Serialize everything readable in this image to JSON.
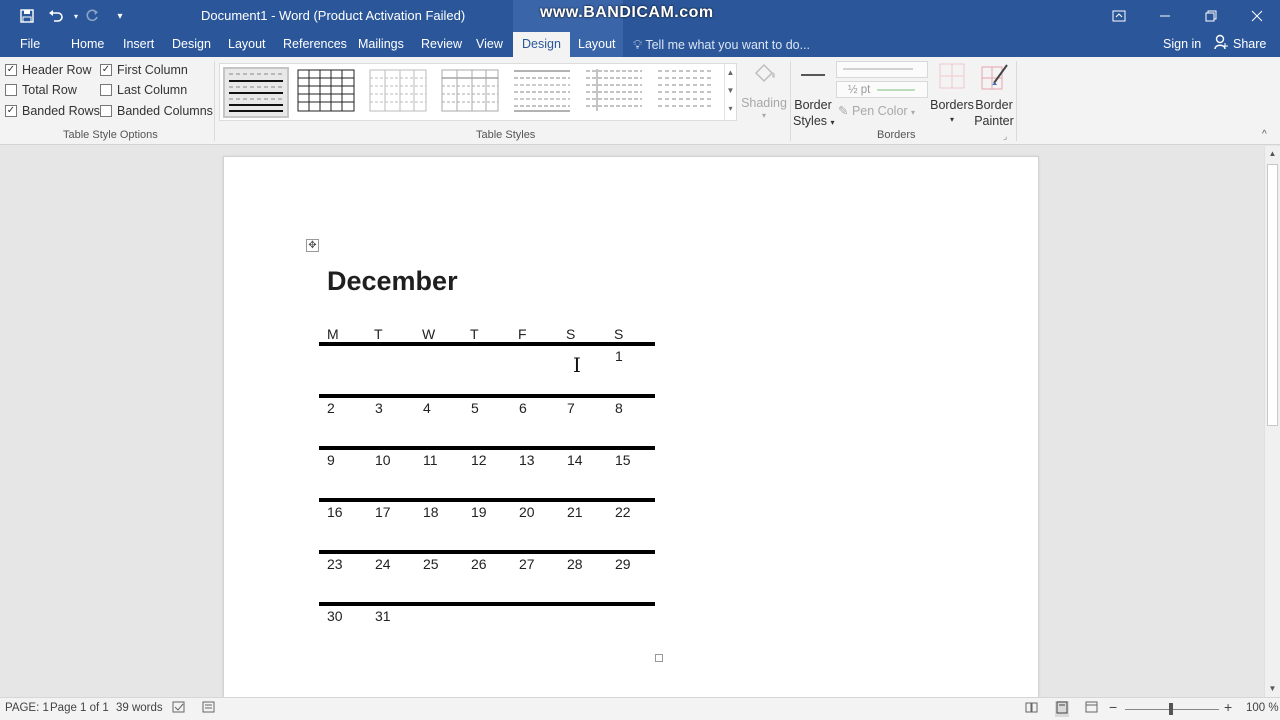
{
  "titlebar": {
    "title": "Document1 - Word (Product Activation Failed)",
    "watermark": "www.BANDICAM.com",
    "save_icon": "save-icon",
    "undo_icon": "undo-icon",
    "redo_icon": "redo-icon",
    "customize_icon": "customize-qat-icon"
  },
  "tabs": {
    "items": [
      "File",
      "Home",
      "Insert",
      "Design",
      "Layout",
      "References",
      "Mailings",
      "Review",
      "View",
      "Design",
      "Layout"
    ],
    "active": "Design",
    "tell_me": "Tell me what you want to do...",
    "sign_in": "Sign in",
    "share": "Share"
  },
  "ribbon": {
    "table_style_options": {
      "label": "Table Style Options",
      "header_row": "Header Row",
      "total_row": "Total Row",
      "banded_rows": "Banded Rows",
      "first_column": "First Column",
      "last_column": "Last Column",
      "banded_columns": "Banded Columns",
      "checked": {
        "header_row": true,
        "total_row": false,
        "banded_rows": true,
        "first_column": true,
        "last_column": false,
        "banded_columns": false
      }
    },
    "table_styles": {
      "label": "Table Styles"
    },
    "shading": "Shading",
    "border_styles_1": "Border",
    "border_styles_2": "Styles",
    "pen_weight": "½ pt",
    "pen_color": "Pen Color",
    "borders": "Borders",
    "border_painter_1": "Border",
    "border_painter_2": "Painter",
    "borders_group_label": "Borders"
  },
  "document": {
    "month": "December",
    "day_headers": [
      "M",
      "T",
      "W",
      "T",
      "F",
      "S",
      "S"
    ],
    "weeks": [
      [
        "",
        "",
        "",
        "",
        "",
        "",
        "1"
      ],
      [
        "2",
        "3",
        "4",
        "5",
        "6",
        "7",
        "8"
      ],
      [
        "9",
        "10",
        "11",
        "12",
        "13",
        "14",
        "15"
      ],
      [
        "16",
        "17",
        "18",
        "19",
        "20",
        "21",
        "22"
      ],
      [
        "23",
        "24",
        "25",
        "26",
        "27",
        "28",
        "29"
      ],
      [
        "30",
        "31",
        "",
        "",
        "",
        "",
        ""
      ]
    ]
  },
  "status": {
    "page_section": "PAGE: 1",
    "page_of": "Page 1 of 1",
    "words": "39 words",
    "zoom": "100 %"
  },
  "colors": {
    "accent": "#2b579a",
    "ribbon": "#f3f3f3",
    "doc_bg": "#e6e6e6"
  }
}
